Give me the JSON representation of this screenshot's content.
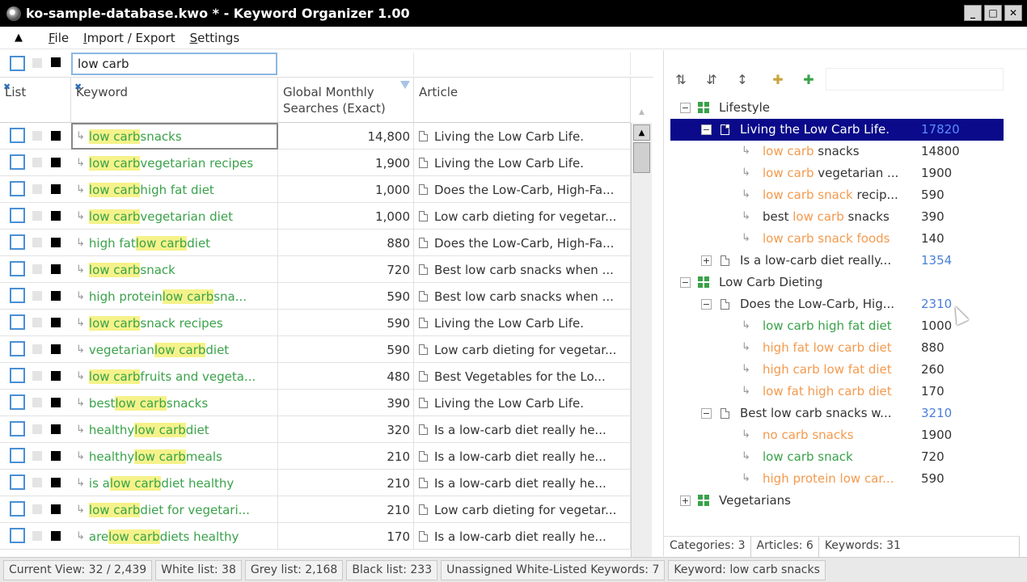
{
  "window": {
    "title": "ko-sample-database.kwo * - Keyword Organizer 1.00",
    "buttons": [
      "_",
      "□",
      "✕"
    ]
  },
  "menu": {
    "items": [
      "File",
      "Import / Export",
      "Settings"
    ]
  },
  "filter": {
    "search_value": "low carb"
  },
  "columns": {
    "list": "List",
    "keyword": "Keyword",
    "searches": "Global Monthly Searches (Exact)",
    "article": "Article"
  },
  "highlight_term": "low carb",
  "rows": [
    {
      "kw_before": "",
      "kw_hl": "low carb",
      "kw_after": " snacks",
      "searches": "14,800",
      "article": "Living the Low Carb Life."
    },
    {
      "kw_before": "",
      "kw_hl": "low carb",
      "kw_after": " vegetarian recipes",
      "searches": "1,900",
      "article": "Living the Low Carb Life."
    },
    {
      "kw_before": "",
      "kw_hl": "low carb",
      "kw_after": " high fat diet",
      "searches": "1,000",
      "article": "Does the Low-Carb, High-Fa..."
    },
    {
      "kw_before": "",
      "kw_hl": "low carb",
      "kw_after": " vegetarian diet",
      "searches": "1,000",
      "article": "Low carb dieting for vegetar..."
    },
    {
      "kw_before": "high fat ",
      "kw_hl": "low carb",
      "kw_after": " diet",
      "searches": "880",
      "article": "Does the Low-Carb, High-Fa..."
    },
    {
      "kw_before": "",
      "kw_hl": "low carb",
      "kw_after": " snack",
      "searches": "720",
      "article": "Best low carb snacks when ..."
    },
    {
      "kw_before": "high protein ",
      "kw_hl": "low carb",
      "kw_after": " sna...",
      "searches": "590",
      "article": "Best low carb snacks when ..."
    },
    {
      "kw_before": "",
      "kw_hl": "low carb",
      "kw_after": " snack recipes",
      "searches": "590",
      "article": "Living the Low Carb Life."
    },
    {
      "kw_before": "vegetarian ",
      "kw_hl": "low carb",
      "kw_after": " diet",
      "searches": "590",
      "article": "Low carb dieting for vegetar..."
    },
    {
      "kw_before": "",
      "kw_hl": "low carb",
      "kw_after": " fruits and vegeta...",
      "searches": "480",
      "article": "Best Vegetables for the Lo..."
    },
    {
      "kw_before": "best ",
      "kw_hl": "low carb",
      "kw_after": " snacks",
      "searches": "390",
      "article": "Living the Low Carb Life."
    },
    {
      "kw_before": "healthy ",
      "kw_hl": "low carb",
      "kw_after": " diet",
      "searches": "320",
      "article": "Is a low-carb diet really he..."
    },
    {
      "kw_before": "healthy ",
      "kw_hl": "low carb",
      "kw_after": " meals",
      "searches": "210",
      "article": "Is a low-carb diet really he..."
    },
    {
      "kw_before": "is a ",
      "kw_hl": "low carb",
      "kw_after": " diet healthy",
      "searches": "210",
      "article": "Is a low-carb diet really he..."
    },
    {
      "kw_before": "",
      "kw_hl": "low carb",
      "kw_after": " diet for vegetari...",
      "searches": "210",
      "article": "Low carb dieting for vegetar..."
    },
    {
      "kw_before": "are ",
      "kw_hl": "low carb",
      "kw_after": " diets healthy",
      "searches": "170",
      "article": "Is a low-carb diet really he..."
    }
  ],
  "tree": [
    {
      "type": "category",
      "expander": "−",
      "label": "Lifestyle",
      "count": "",
      "level": 0,
      "color": "dark"
    },
    {
      "type": "article",
      "expander": "−",
      "label": "Living the Low Carb Life.",
      "count": "17820",
      "level": 1,
      "color": "dark",
      "selected": true
    },
    {
      "type": "keyword",
      "parts": [
        {
          "t": "low carb",
          "c": "orange"
        },
        {
          "t": " snacks",
          "c": "dark"
        }
      ],
      "count": "14800",
      "level": 2
    },
    {
      "type": "keyword",
      "parts": [
        {
          "t": "low carb",
          "c": "orange"
        },
        {
          "t": " vegetarian ...",
          "c": "dark"
        }
      ],
      "count": "1900",
      "level": 2
    },
    {
      "type": "keyword",
      "parts": [
        {
          "t": "low carb snack",
          "c": "orange"
        },
        {
          "t": " recip...",
          "c": "dark"
        }
      ],
      "count": "590",
      "level": 2
    },
    {
      "type": "keyword",
      "parts": [
        {
          "t": "best ",
          "c": "dark"
        },
        {
          "t": "low carb",
          "c": "orange"
        },
        {
          "t": " snacks",
          "c": "dark"
        }
      ],
      "count": "390",
      "level": 2
    },
    {
      "type": "keyword",
      "parts": [
        {
          "t": "low carb snack foods",
          "c": "orange"
        }
      ],
      "count": "140",
      "level": 2
    },
    {
      "type": "article",
      "expander": "+",
      "label": "Is a low-carb diet really...",
      "count": "1354",
      "level": 1,
      "color": "dark"
    },
    {
      "type": "category",
      "expander": "−",
      "label": "Low Carb Dieting",
      "count": "",
      "level": 0,
      "color": "dark"
    },
    {
      "type": "article",
      "expander": "−",
      "label": "Does the Low-Carb, Hig...",
      "count": "2310",
      "level": 1,
      "color": "dark"
    },
    {
      "type": "keyword",
      "parts": [
        {
          "t": "low carb high fat diet",
          "c": "green"
        }
      ],
      "count": "1000",
      "level": 2
    },
    {
      "type": "keyword",
      "parts": [
        {
          "t": "high fat low carb diet",
          "c": "orange"
        }
      ],
      "count": "880",
      "level": 2
    },
    {
      "type": "keyword",
      "parts": [
        {
          "t": "high carb low fat diet",
          "c": "orange"
        }
      ],
      "count": "260",
      "level": 2
    },
    {
      "type": "keyword",
      "parts": [
        {
          "t": "low fat high carb diet",
          "c": "orange"
        }
      ],
      "count": "170",
      "level": 2
    },
    {
      "type": "article",
      "expander": "−",
      "label": "Best low carb snacks w...",
      "count": "3210",
      "level": 1,
      "color": "dark"
    },
    {
      "type": "keyword",
      "parts": [
        {
          "t": "no carb snacks",
          "c": "orange"
        }
      ],
      "count": "1900",
      "level": 2
    },
    {
      "type": "keyword",
      "parts": [
        {
          "t": "low carb snack",
          "c": "green"
        }
      ],
      "count": "720",
      "level": 2
    },
    {
      "type": "keyword",
      "parts": [
        {
          "t": "high protein low car...",
          "c": "orange"
        }
      ],
      "count": "590",
      "level": 2
    },
    {
      "type": "category",
      "expander": "+",
      "label": "Vegetarians",
      "count": "",
      "level": 0,
      "color": "dark"
    }
  ],
  "right_status": {
    "categories": "Categories: 3",
    "articles": "Articles: 6",
    "keywords": "Keywords: 31"
  },
  "status": {
    "current_view": "Current View: 32 / 2,439",
    "white_list": "White list: 38",
    "grey_list": "Grey list: 2,168",
    "black_list": "Black list: 233",
    "unassigned": "Unassigned White-Listed Keywords: 7",
    "keyword": "Keyword: low carb snacks"
  },
  "colors": {
    "highlight": "#f5f28a",
    "keyword_green": "#3aa24a",
    "keyword_orange": "#f39a4e",
    "count_blue": "#4a7fd8",
    "selection": "#0a0a8a"
  }
}
